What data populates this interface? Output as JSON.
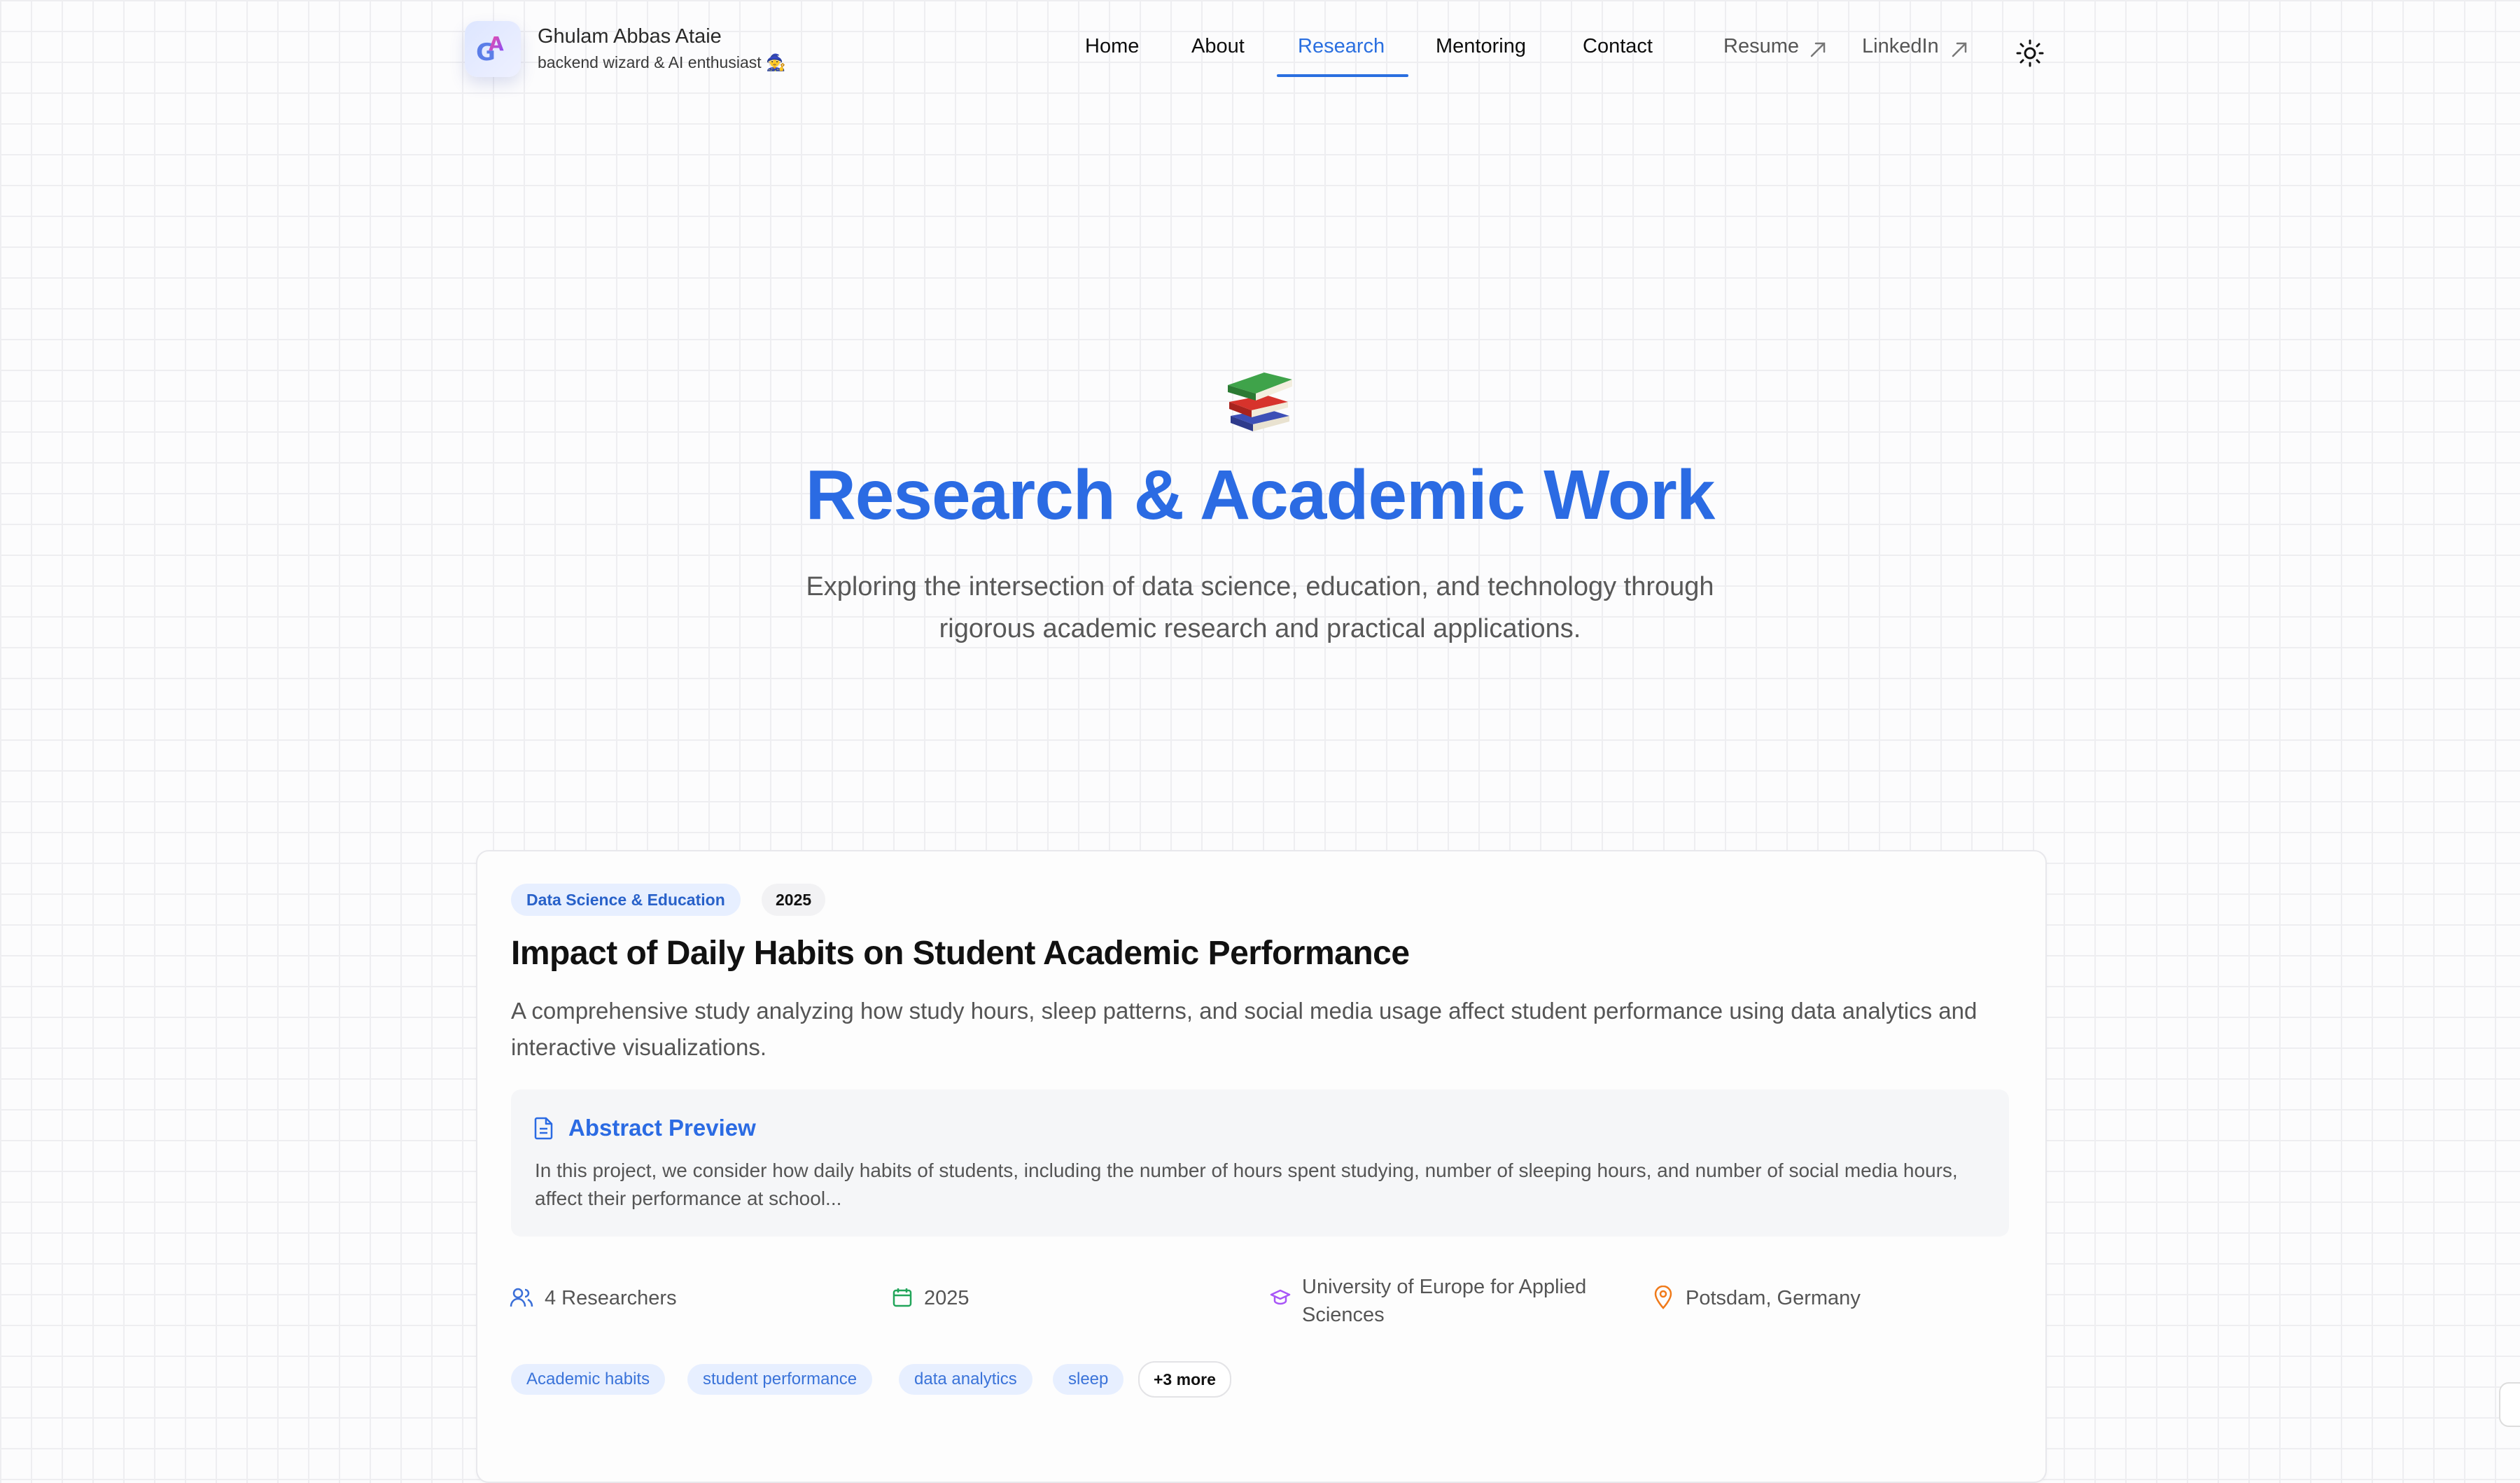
{
  "brand": {
    "name": "Ghulam Abbas Ataie",
    "tagline": "backend wizard & AI enthusiast 🧙",
    "logo_letters": "GA"
  },
  "nav": {
    "items": [
      {
        "label": "Home"
      },
      {
        "label": "About"
      },
      {
        "label": "Research",
        "active": true
      },
      {
        "label": "Mentoring"
      },
      {
        "label": "Contact"
      }
    ],
    "external": [
      {
        "label": "Resume",
        "icon": "external-arrow-icon"
      },
      {
        "label": "LinkedIn",
        "icon": "external-arrow-icon"
      }
    ],
    "theme_icon": "sun-icon"
  },
  "hero": {
    "icon": "books-icon",
    "title": "Research & Academic Work",
    "subtitle": "Exploring the intersection of data science, education, and technology through rigorous academic research and practical applications."
  },
  "project": {
    "category": "Data Science & Education",
    "year_badge": "2025",
    "title": "Impact of Daily Habits on Student Academic Performance",
    "description": "A comprehensive study analyzing how study hours, sleep patterns, and social media usage affect student performance using data analytics and interactive visualizations.",
    "abstract": {
      "title": "Abstract Preview",
      "text": "In this project, we consider how daily habits of students, including the number of hours spent studying, number of sleeping hours, and number of social media hours, affect their performance at school..."
    },
    "meta": {
      "researchers": "4 Researchers",
      "year": "2025",
      "university": "University of Europe for Applied Sciences",
      "location": "Potsdam, Germany"
    },
    "tags": [
      "Academic habits",
      "student performance",
      "data analytics",
      "sleep"
    ],
    "more_tags": "+3 more"
  },
  "colors": {
    "accent": "#2b6be3",
    "badge_bg": "#e7efff",
    "researchers_icon": "#3b6fd8",
    "calendar_icon": "#22a55a",
    "university_icon": "#a855f7",
    "location_icon": "#f07a1a"
  }
}
